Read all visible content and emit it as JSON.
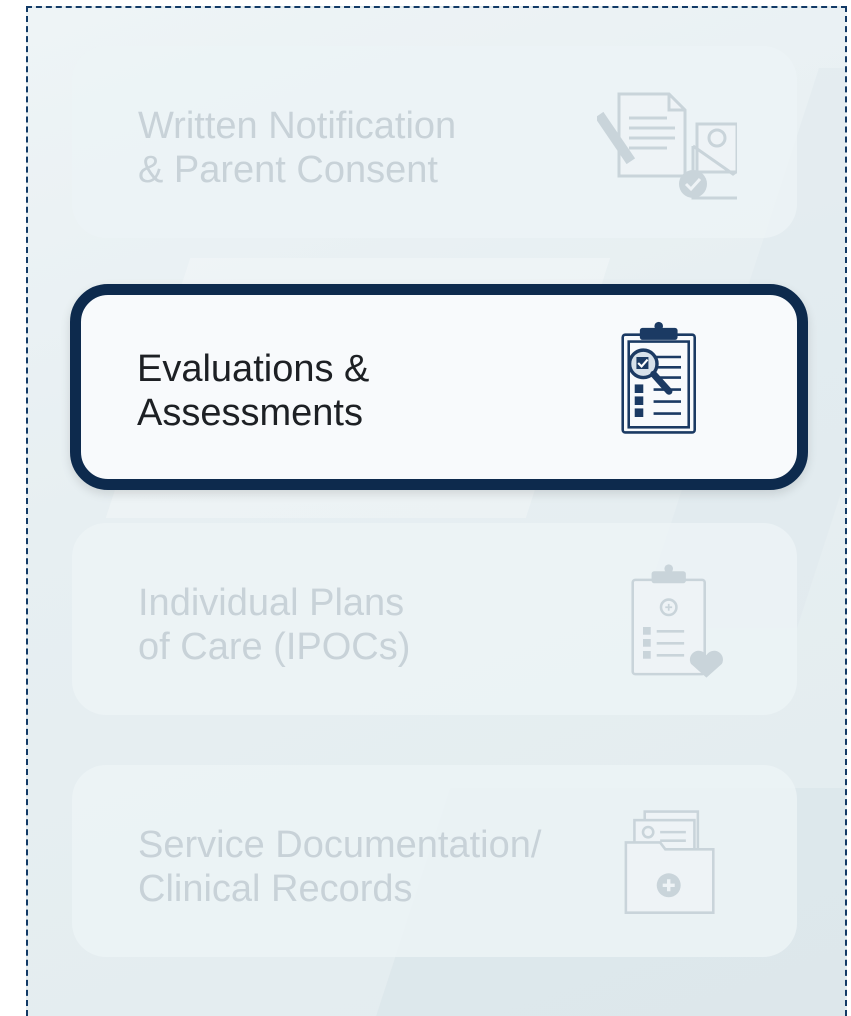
{
  "menu": {
    "items": [
      {
        "label": "Written Notification\n& Parent Consent",
        "icon": "documents-envelope-icon",
        "active": false
      },
      {
        "label": "Evaluations &\nAssessments",
        "icon": "clipboard-magnifier-icon",
        "active": true
      },
      {
        "label": "Individual Plans\nof Care (IPOCs)",
        "icon": "clipboard-heart-icon",
        "active": false
      },
      {
        "label": "Service Documentation/\nClinical Records",
        "icon": "folder-medical-icon",
        "active": false
      }
    ]
  },
  "colors": {
    "active_border": "#0d2a4d",
    "active_text": "#1d2024",
    "inactive_text": "#c8d2d8",
    "icon_active": "#1b3a63",
    "icon_inactive": "#c9d4da",
    "frame_border": "#123a66"
  }
}
